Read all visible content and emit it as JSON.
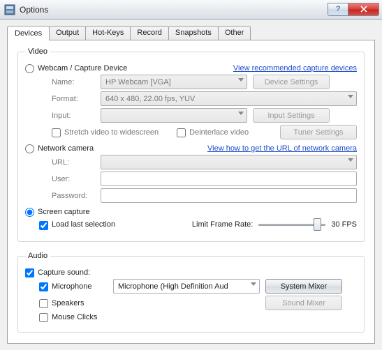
{
  "window": {
    "title": "Options"
  },
  "tabs": [
    "Devices",
    "Output",
    "Hot-Keys",
    "Record",
    "Snapshots",
    "Other"
  ],
  "video": {
    "legend": "Video",
    "webcam": {
      "radio": "Webcam / Capture Device",
      "link": "View recommended capture devices",
      "name_label": "Name:",
      "name_value": "HP Webcam [VGA]",
      "device_settings_btn": "Device Settings",
      "format_label": "Format:",
      "format_value": "640 x 480, 22.00 fps, YUV",
      "input_label": "Input:",
      "input_value": "",
      "input_settings_btn": "Input Settings",
      "stretch_cb": "Stretch video to widescreen",
      "deinterlace_cb": "Deinterlace video",
      "tuner_btn": "Tuner Settings"
    },
    "network": {
      "radio": "Network camera",
      "link": "View how to get the URL of network camera",
      "url_label": "URL:",
      "user_label": "User:",
      "password_label": "Password:"
    },
    "screen": {
      "radio": "Screen capture",
      "load_last_cb": "Load last selection",
      "limit_label": "Limit Frame Rate:",
      "fps_text": "30 FPS"
    }
  },
  "audio": {
    "legend": "Audio",
    "capture_cb": "Capture sound:",
    "mic_cb": "Microphone",
    "mic_value": "Microphone (High Definition Aud",
    "system_mixer_btn": "System Mixer",
    "speakers_cb": "Speakers",
    "sound_mixer_btn": "Sound Mixer",
    "mouse_clicks_cb": "Mouse Clicks"
  }
}
